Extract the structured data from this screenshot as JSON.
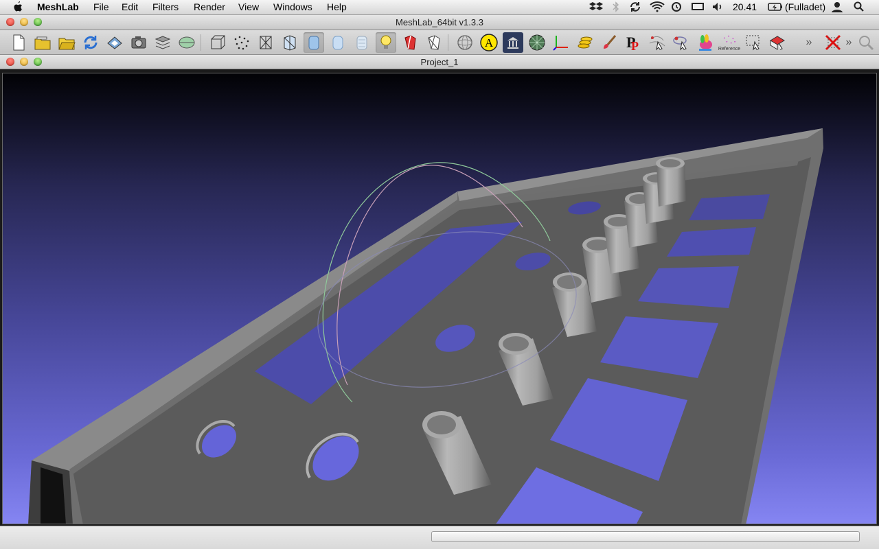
{
  "menubar": {
    "apple": "",
    "app_name": "MeshLab",
    "items": [
      "File",
      "Edit",
      "Filters",
      "Render",
      "View",
      "Windows",
      "Help"
    ],
    "clock": "20.41",
    "battery": "(Fulladet)"
  },
  "window": {
    "title": "MeshLab_64bit v1.3.3"
  },
  "document": {
    "title": "Project_1"
  },
  "toolbar": {
    "annotation_label": "A",
    "reference_label": "Reference",
    "overflow_1": "»",
    "overflow_2": "»",
    "buttons": [
      {
        "icon": "new-file-icon"
      },
      {
        "icon": "open-project-icon"
      },
      {
        "icon": "open-folder-icon"
      },
      {
        "icon": "reload-icon"
      },
      {
        "icon": "save-icon"
      },
      {
        "icon": "snapshot-camera-icon"
      },
      {
        "icon": "layers-icon"
      },
      {
        "icon": "globe-icon"
      },
      {
        "icon": "bounding-box-icon"
      },
      {
        "icon": "points-icon"
      },
      {
        "icon": "wireframe-icon"
      },
      {
        "icon": "hidden-lines-icon"
      },
      {
        "icon": "flat-shading-icon"
      },
      {
        "icon": "smooth-shading-icon"
      },
      {
        "icon": "texture-icon"
      },
      {
        "icon": "light-bulb-icon"
      },
      {
        "icon": "backface-icon"
      },
      {
        "icon": "select-faces-icon"
      },
      {
        "icon": "trackball-icon"
      },
      {
        "icon": "annotation-icon"
      },
      {
        "icon": "museum-icon"
      },
      {
        "icon": "mesh-sphere-icon"
      },
      {
        "icon": "axes-icon"
      },
      {
        "icon": "coins-icon"
      },
      {
        "icon": "paint-brush-icon"
      },
      {
        "icon": "pp-picker-icon"
      },
      {
        "icon": "pick-points-icon"
      },
      {
        "icon": "align-icon"
      },
      {
        "icon": "color-bunny-icon"
      },
      {
        "icon": "reference-icon"
      },
      {
        "icon": "select-region-icon"
      },
      {
        "icon": "z-painting-icon"
      },
      {
        "icon": "no-edit-icon"
      },
      {
        "icon": "search-icon"
      }
    ]
  },
  "statusbar": {
    "progress": 0
  },
  "colors": {
    "viewport_bg_top": "#020205",
    "viewport_bg_bottom": "#8585f2",
    "mesh": "#5b5b5b"
  }
}
